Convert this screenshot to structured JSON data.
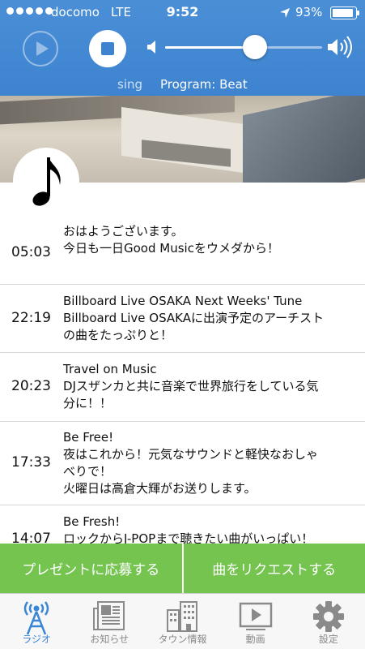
{
  "status_bar": {
    "carrier": "docomo",
    "network": "LTE",
    "time": "9:52",
    "battery_percent_label": "93%",
    "battery_level": 0.93
  },
  "player": {
    "volume_level": 0.57,
    "marquee_previous_fragment": "sing",
    "program_label": "Program: Beat"
  },
  "schedule": [
    {
      "time": "05:03",
      "lines": [
        "おはようございます。",
        "今日も一日Good Musicをウメダから！"
      ]
    },
    {
      "time": "22:19",
      "lines": [
        "Billboard Live OSAKA Next Weeks' Tune",
        "Billboard Live OSAKAに出演予定のアーチスト",
        "の曲をたっぷりと！"
      ]
    },
    {
      "time": "20:23",
      "lines": [
        "Travel on Music",
        "DJスザンカと共に音楽で世界旅行をしている気",
        "分に！！"
      ]
    },
    {
      "time": "17:33",
      "lines": [
        "Be Free!",
        "夜はこれから！元気なサウンドと軽快なおしゃ",
        "べりで！",
        "火曜日は高倉大輝がお送りします。"
      ]
    },
    {
      "time": "14:07",
      "lines": [
        "Be Fresh!",
        "ロックからJ-POPまで聴きたい曲がいっぱい！"
      ]
    }
  ],
  "actions": {
    "present_label": "プレゼントに応募する",
    "request_label": "曲をリクエストする"
  },
  "tabs": [
    {
      "label": "ラジオ",
      "icon": "radio-tower-icon",
      "active": true
    },
    {
      "label": "お知らせ",
      "icon": "newspaper-icon",
      "active": false
    },
    {
      "label": "タウン情報",
      "icon": "buildings-icon",
      "active": false
    },
    {
      "label": "動画",
      "icon": "video-play-icon",
      "active": false
    },
    {
      "label": "設定",
      "icon": "gear-icon",
      "active": false
    }
  ],
  "colors": {
    "header_blue": "#3d83cf",
    "action_green": "#75c450",
    "tab_active": "#3a86d6",
    "tab_inactive": "#8a8a8a"
  }
}
